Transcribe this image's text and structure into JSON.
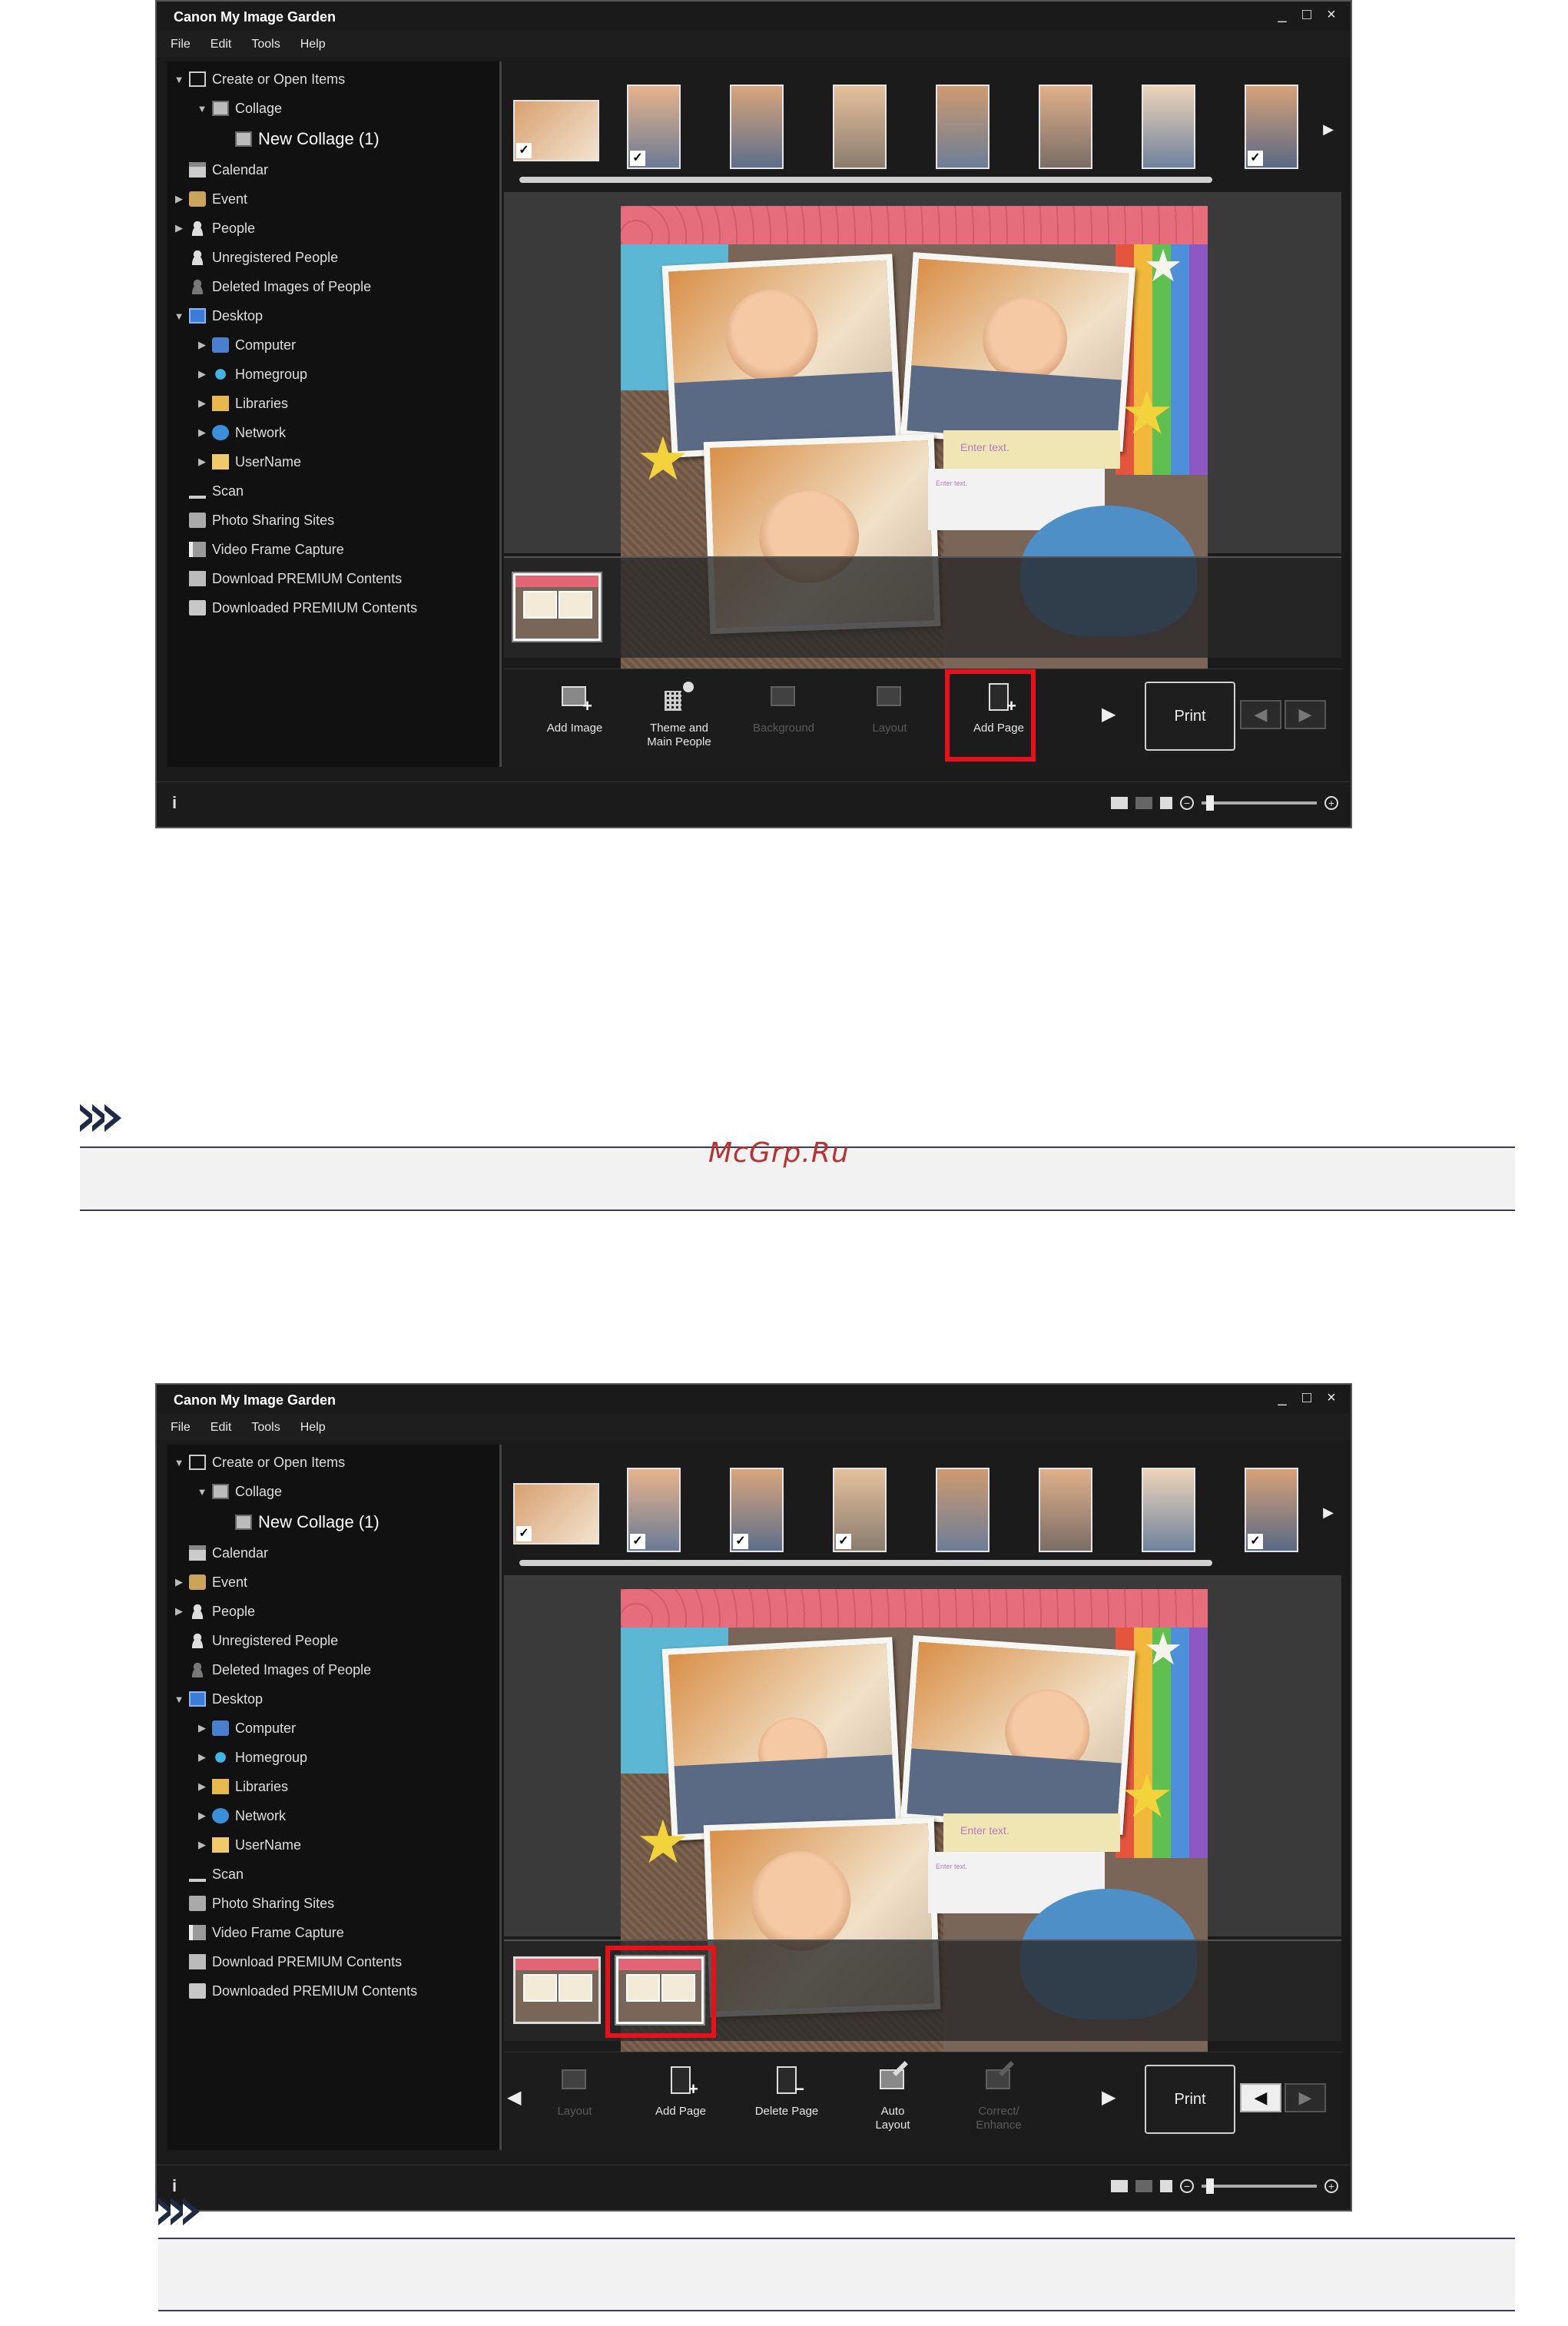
{
  "app": {
    "title": "Canon My Image Garden",
    "window_buttons": [
      "_",
      "□",
      "×"
    ],
    "menu": [
      "File",
      "Edit",
      "Tools",
      "Help"
    ],
    "sidebar": [
      {
        "label": "Create or Open Items",
        "icon": "create-items-icon",
        "arrow": "▼"
      },
      {
        "label": "Collage",
        "icon": "collage-icon",
        "arrow": "▼"
      },
      {
        "label": "New Collage (1)",
        "icon": "collage-item-icon",
        "arrow": ""
      },
      {
        "label": "Calendar",
        "icon": "calendar-icon",
        "arrow": ""
      },
      {
        "label": "Event",
        "icon": "event-icon",
        "arrow": "▶"
      },
      {
        "label": "People",
        "icon": "people-icon",
        "arrow": "▶"
      },
      {
        "label": "Unregistered People",
        "icon": "unregistered-people-icon",
        "arrow": ""
      },
      {
        "label": "Deleted Images of People",
        "icon": "deleted-people-icon",
        "arrow": ""
      },
      {
        "label": "Desktop",
        "icon": "desktop-icon",
        "arrow": "▼"
      },
      {
        "label": "Computer",
        "icon": "computer-icon",
        "arrow": "▶"
      },
      {
        "label": "Homegroup",
        "icon": "homegroup-icon",
        "arrow": "▶"
      },
      {
        "label": "Libraries",
        "icon": "libraries-icon",
        "arrow": "▶"
      },
      {
        "label": "Network",
        "icon": "network-icon",
        "arrow": "▶"
      },
      {
        "label": "UserName",
        "icon": "user-folder-icon",
        "arrow": "▶"
      },
      {
        "label": "Scan",
        "icon": "scan-icon",
        "arrow": ""
      },
      {
        "label": "Photo Sharing Sites",
        "icon": "photo-sharing-icon",
        "arrow": ""
      },
      {
        "label": "Video Frame Capture",
        "icon": "video-capture-icon",
        "arrow": ""
      },
      {
        "label": "Download PREMIUM Contents",
        "icon": "download-premium-icon",
        "arrow": ""
      },
      {
        "label": "Downloaded PREMIUM Contents",
        "icon": "downloaded-premium-icon",
        "arrow": ""
      }
    ],
    "canvas_text": {
      "enter_text": "Enter text.",
      "small_text": "Enter text."
    },
    "print_label": "Print",
    "status_info": "i",
    "strip_arrow": "▶"
  },
  "screen1": {
    "tools": [
      {
        "label": "Add Image",
        "enabled": true
      },
      {
        "label": "Theme and Main People",
        "enabled": true
      },
      {
        "label": "Background",
        "enabled": false
      },
      {
        "label": "Layout",
        "enabled": false
      },
      {
        "label": "Add Page",
        "enabled": true,
        "highlighted": true
      }
    ],
    "pages_count": 1,
    "prev_enabled": false,
    "next_enabled": false
  },
  "screen2": {
    "tools": [
      {
        "label": "Layout",
        "enabled": false
      },
      {
        "label": "Add Page",
        "enabled": true
      },
      {
        "label": "Delete Page",
        "enabled": true
      },
      {
        "label": "Auto Layout",
        "enabled": true
      },
      {
        "label": "Correct/ Enhance",
        "enabled": false
      }
    ],
    "pages_count": 2,
    "selected_page": 2,
    "prev_enabled": true,
    "next_enabled": false
  },
  "watermark": "McGrp.Ru",
  "colors": {
    "highlight": "#e8101a",
    "note_rule": "#3b3b55",
    "watermark": "#b83232"
  }
}
